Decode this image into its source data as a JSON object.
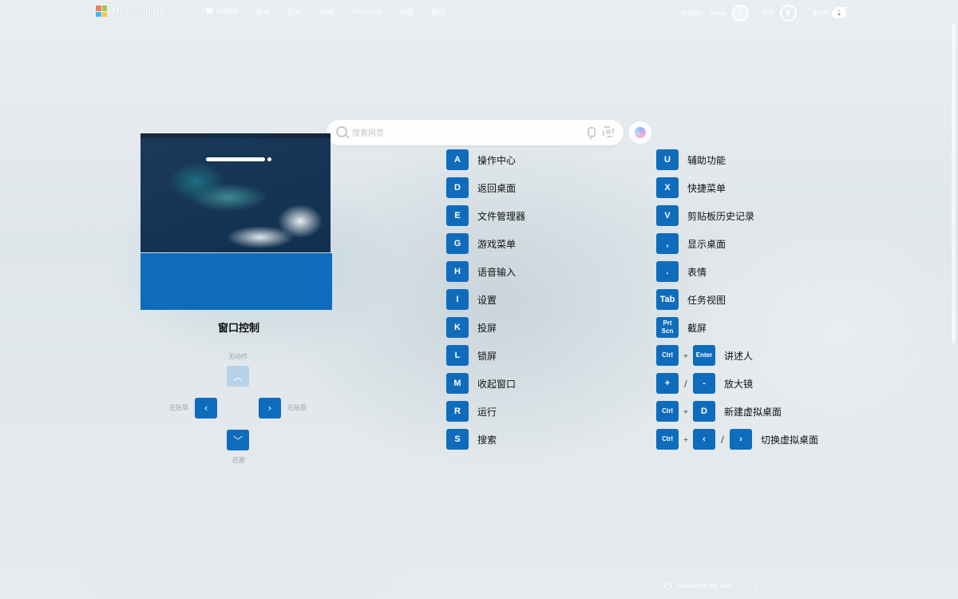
{
  "header": {
    "logo_text": "Microsoft Bing",
    "nav": [
      {
        "label": "Copilot"
      },
      {
        "label": "学术"
      },
      {
        "label": "图片"
      },
      {
        "label": "视频"
      },
      {
        "label": "Shopping"
      },
      {
        "label": "地图"
      },
      {
        "label": "翻译"
      },
      {
        "label": "···"
      }
    ],
    "language": "English",
    "user_name": "Zarya",
    "rewards_points": "675",
    "wallet": "$0.00",
    "wallet_badge": "1"
  },
  "search": {
    "placeholder": "搜索网页"
  },
  "window_control": {
    "title": "窗口控制",
    "up_label": "无动作",
    "left_label": "左贴靠",
    "right_label": "右贴靠",
    "down_label": "还原"
  },
  "shortcuts_left": [
    {
      "key": "A",
      "label": "操作中心"
    },
    {
      "key": "D",
      "label": "返回桌面"
    },
    {
      "key": "E",
      "label": "文件管理器"
    },
    {
      "key": "G",
      "label": "游戏菜单"
    },
    {
      "key": "H",
      "label": "语音输入"
    },
    {
      "key": "I",
      "label": "设置"
    },
    {
      "key": "K",
      "label": "投屏"
    },
    {
      "key": "L",
      "label": "锁屏"
    },
    {
      "key": "M",
      "label": "收起窗口"
    },
    {
      "key": "R",
      "label": "运行"
    },
    {
      "key": "S",
      "label": "搜索"
    }
  ],
  "shortcuts_right": [
    {
      "key": "U",
      "label": "辅助功能"
    },
    {
      "key": "X",
      "label": "快捷菜单"
    },
    {
      "key": "V",
      "label": "剪贴板历史记录"
    },
    {
      "key": ",",
      "label": "显示桌面"
    },
    {
      "key": ".",
      "label": "表情"
    },
    {
      "key": "Tab",
      "label": "任务视图"
    },
    {
      "key": "Prt Scn",
      "label": "截屏"
    }
  ],
  "combos": {
    "narrator": {
      "k1": "Ctrl",
      "sep": "+",
      "k2": "Enter",
      "label": "讲述人"
    },
    "magnifier": {
      "k1": "+",
      "sep": "/",
      "k2": "-",
      "label": "放大镜"
    },
    "new_desktop": {
      "k1": "Ctrl",
      "sep": "+",
      "k2": "D",
      "label": "新建虚拟桌面"
    },
    "switch_desktop": {
      "k1": "Ctrl",
      "sep": "+",
      "sep2": "/",
      "label": "切换虚拟桌面"
    }
  },
  "footer": {
    "caption": "A dive into the blue"
  },
  "colors": {
    "key_blue": "#0f6cbd",
    "key_disabled": "#b7d3ea"
  }
}
